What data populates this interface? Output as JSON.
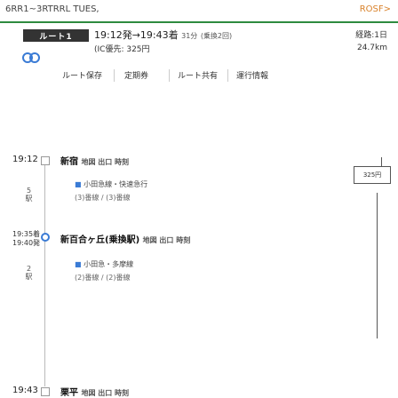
{
  "notice": {
    "text": "6RR1~3RTRRL TUES,",
    "link": "ROSF>"
  },
  "route": {
    "badge": "ルート1",
    "times": "19:12発→19:43着",
    "duration": "31分",
    "transfer": "(乗換2回)",
    "fare": "(IC優先: 325円",
    "right_top": "経路:1日",
    "right_distance": "24.7km"
  },
  "options": [
    "ルート保存",
    "定期券",
    "ルート共有",
    "運行情報"
  ],
  "timeline": {
    "t1": "19:12",
    "s1_name": "新宿",
    "s1_tags": "地図 出口 時刻",
    "seg1_line": "小田急線・快速急行",
    "seg1_detail": "(3)番線 / (3)番線",
    "seg1_label": "5駅",
    "fare_value": "325円",
    "t2": "19:35着",
    "t2b": "19:40発",
    "s2_name": "新百合ヶ丘(乗換駅)",
    "s2_tags": "地図 出口 時刻",
    "seg2_line": "小田急・多摩線",
    "seg2_detail": "(2)番線 / (2)番線",
    "seg2_label": "2駅",
    "t3": "19:43",
    "s3_name": "栗平",
    "s3_tags": "地図 出口 時刻"
  },
  "colors": {
    "accent_green": "#2e8b3e",
    "link_orange": "#d9822b",
    "line_blue": "#3a7bd5"
  }
}
